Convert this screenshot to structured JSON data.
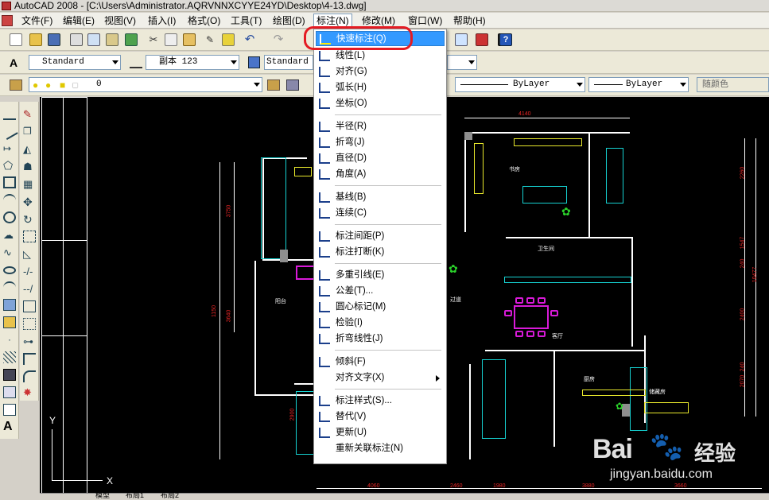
{
  "window": {
    "title": "AutoCAD 2008 - [C:\\Users\\Administrator.AQRVNNXCYYE24YD\\Desktop\\4-13.dwg]"
  },
  "menubar": {
    "items": [
      "文件(F)",
      "编辑(E)",
      "视图(V)",
      "插入(I)",
      "格式(O)",
      "工具(T)",
      "绘图(D)",
      "标注(N)",
      "修改(M)",
      "窗口(W)",
      "帮助(H)"
    ],
    "open_index": 7
  },
  "styles_toolbar": {
    "text_style": "Standard",
    "dim_style": "副本 123",
    "table_style": "Standard"
  },
  "layers_toolbar": {
    "layer": "0",
    "linetype": "ByLayer",
    "lineweight": "ByLayer",
    "plot_style": "随颜色"
  },
  "dim_menu": {
    "items": [
      {
        "label": "快速标注(Q)",
        "icon": "quick-dimension-icon",
        "highlighted": true
      },
      {
        "label": "线性(L)",
        "icon": "linear-dimension-icon"
      },
      {
        "label": "对齐(G)",
        "icon": "aligned-dimension-icon"
      },
      {
        "label": "弧长(H)",
        "icon": "arc-length-icon"
      },
      {
        "label": "坐标(O)",
        "icon": "ordinate-icon"
      },
      {
        "label": "半径(R)",
        "icon": "radius-icon"
      },
      {
        "label": "折弯(J)",
        "icon": "jogged-icon"
      },
      {
        "label": "直径(D)",
        "icon": "diameter-icon"
      },
      {
        "label": "角度(A)",
        "icon": "angular-icon"
      },
      {
        "label": "基线(B)",
        "icon": "baseline-icon"
      },
      {
        "label": "连续(C)",
        "icon": "continue-icon"
      },
      {
        "label": "标注间距(P)",
        "icon": "dim-space-icon"
      },
      {
        "label": "标注打断(K)",
        "icon": "dim-break-icon"
      },
      {
        "label": "多重引线(E)",
        "icon": "multileader-icon"
      },
      {
        "label": "公差(T)...",
        "icon": "tolerance-icon"
      },
      {
        "label": "圆心标记(M)",
        "icon": "center-mark-icon"
      },
      {
        "label": "检验(I)",
        "icon": "inspection-icon"
      },
      {
        "label": "折弯线性(J)",
        "icon": "jogged-linear-icon"
      },
      {
        "label": "倾斜(F)",
        "icon": "oblique-icon"
      },
      {
        "label": "对齐文字(X)",
        "icon": "",
        "submenu": true
      },
      {
        "label": "标注样式(S)...",
        "icon": "dim-style-icon"
      },
      {
        "label": "替代(V)",
        "icon": "override-icon"
      },
      {
        "label": "更新(U)",
        "icon": "update-icon"
      },
      {
        "label": "重新关联标注(N)",
        "icon": ""
      }
    ]
  },
  "drawing": {
    "room_labels": [
      "书房",
      "卫生间",
      "阳台",
      "过道",
      "客厅",
      "厨房",
      "储藏房",
      "阳台"
    ],
    "dim_top": [
      "4140"
    ],
    "dim_bottom": [
      "4060",
      "2460",
      "1980",
      "3880",
      "3660"
    ],
    "dim_right": [
      "2260",
      "1547",
      "240",
      "10477",
      "2400",
      "2070",
      "240"
    ],
    "dim_left": [
      "3750",
      "1150",
      "3640",
      "2900"
    ],
    "axis_y": "Y",
    "axis_x": "X"
  },
  "layout_tabs": [
    "模型",
    "布局1",
    "布局2"
  ],
  "watermark": {
    "brand": "Bai",
    "brand2": "经验",
    "url": "jingyan.baidu.com"
  },
  "colors": {
    "highlight": "#3399ff",
    "annotation": "#e41b23",
    "canvas": "#000000",
    "cyan": "#16d1d1",
    "magenta": "#d81ad8",
    "yellow": "#e9e92c"
  }
}
